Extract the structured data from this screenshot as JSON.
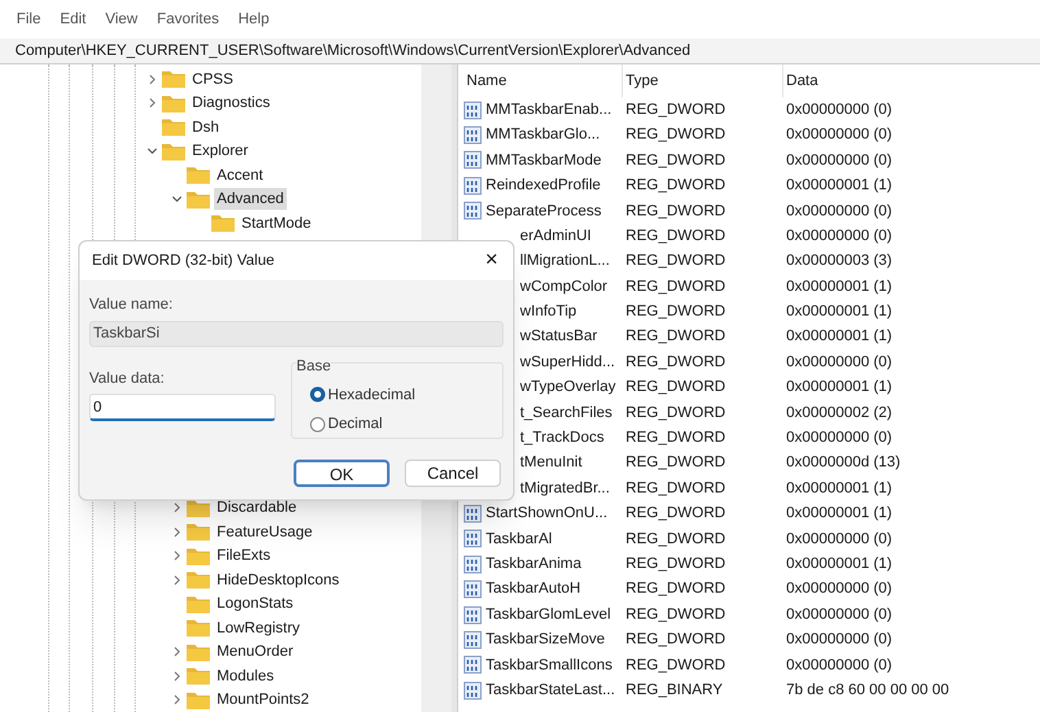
{
  "menu": [
    "File",
    "Edit",
    "View",
    "Favorites",
    "Help"
  ],
  "address": "Computer\\HKEY_CURRENT_USER\\Software\\Microsoft\\Windows\\CurrentVersion\\Explorer\\Advanced",
  "tree": {
    "upper": [
      {
        "label": "CPSS",
        "expandable": true,
        "expanded": false,
        "selected": false
      },
      {
        "label": "Diagnostics",
        "expandable": true,
        "expanded": false,
        "selected": false
      },
      {
        "label": "Dsh",
        "expandable": false,
        "selected": false
      },
      {
        "label": "Explorer",
        "expandable": true,
        "expanded": true,
        "selected": false,
        "children": [
          {
            "label": "Accent",
            "expandable": false,
            "selected": false
          },
          {
            "label": "Advanced",
            "expandable": true,
            "expanded": true,
            "selected": true,
            "children": [
              {
                "label": "StartMode",
                "expandable": false,
                "selected": false
              }
            ]
          }
        ]
      }
    ],
    "lower": [
      {
        "label": "Discardable",
        "expandable": true,
        "expanded": false,
        "selected": false
      },
      {
        "label": "FeatureUsage",
        "expandable": true,
        "expanded": false,
        "selected": false
      },
      {
        "label": "FileExts",
        "expandable": true,
        "expanded": false,
        "selected": false
      },
      {
        "label": "HideDesktopIcons",
        "expandable": true,
        "expanded": false,
        "selected": false
      },
      {
        "label": "LogonStats",
        "expandable": false,
        "selected": false
      },
      {
        "label": "LowRegistry",
        "expandable": false,
        "selected": false
      },
      {
        "label": "MenuOrder",
        "expandable": true,
        "expanded": false,
        "selected": false
      },
      {
        "label": "Modules",
        "expandable": true,
        "expanded": false,
        "selected": false
      },
      {
        "label": "MountPoints2",
        "expandable": true,
        "expanded": false,
        "selected": false
      }
    ]
  },
  "table": {
    "columns": [
      "Name",
      "Type",
      "Data"
    ],
    "rows": [
      {
        "kind": "full",
        "name": "MMTaskbarEnab...",
        "type": "REG_DWORD",
        "data": "0x00000000 (0)"
      },
      {
        "kind": "full",
        "name": "MMTaskbarGlo...",
        "type": "REG_DWORD",
        "data": "0x00000000 (0)"
      },
      {
        "kind": "full",
        "name": "MMTaskbarMode",
        "type": "REG_DWORD",
        "data": "0x00000000 (0)"
      },
      {
        "kind": "full",
        "name": "ReindexedProfile",
        "type": "REG_DWORD",
        "data": "0x00000001 (1)"
      },
      {
        "kind": "full",
        "name": "SeparateProcess",
        "type": "REG_DWORD",
        "data": "0x00000000 (0)"
      },
      {
        "kind": "partial",
        "name": "erAdminUI",
        "type": "REG_DWORD",
        "data": "0x00000000 (0)"
      },
      {
        "kind": "partial",
        "name": "llMigrationL...",
        "type": "REG_DWORD",
        "data": "0x00000003 (3)"
      },
      {
        "kind": "partial",
        "name": "wCompColor",
        "type": "REG_DWORD",
        "data": "0x00000001 (1)"
      },
      {
        "kind": "partial",
        "name": "wInfoTip",
        "type": "REG_DWORD",
        "data": "0x00000001 (1)"
      },
      {
        "kind": "partial",
        "name": "wStatusBar",
        "type": "REG_DWORD",
        "data": "0x00000001 (1)"
      },
      {
        "kind": "partial",
        "name": "wSuperHidd...",
        "type": "REG_DWORD",
        "data": "0x00000000 (0)"
      },
      {
        "kind": "partial",
        "name": "wTypeOverlay",
        "type": "REG_DWORD",
        "data": "0x00000001 (1)"
      },
      {
        "kind": "partial",
        "name": "t_SearchFiles",
        "type": "REG_DWORD",
        "data": "0x00000002 (2)"
      },
      {
        "kind": "partial",
        "name": "t_TrackDocs",
        "type": "REG_DWORD",
        "data": "0x00000000 (0)"
      },
      {
        "kind": "partial",
        "name": "tMenuInit",
        "type": "REG_DWORD",
        "data": "0x0000000d (13)"
      },
      {
        "kind": "partial",
        "name": "tMigratedBr...",
        "type": "REG_DWORD",
        "data": "0x00000001 (1)"
      },
      {
        "kind": "full",
        "name": "StartShownOnU...",
        "type": "REG_DWORD",
        "data": "0x00000001 (1)"
      },
      {
        "kind": "full",
        "name": "TaskbarAl",
        "type": "REG_DWORD",
        "data": "0x00000000 (0)"
      },
      {
        "kind": "full",
        "name": "TaskbarAnima",
        "type": "REG_DWORD",
        "data": "0x00000001 (1)"
      },
      {
        "kind": "full",
        "name": "TaskbarAutoH",
        "type": "REG_DWORD",
        "data": "0x00000000 (0)"
      },
      {
        "kind": "full",
        "name": "TaskbarGlomLevel",
        "type": "REG_DWORD",
        "data": "0x00000000 (0)"
      },
      {
        "kind": "full",
        "name": "TaskbarSizeMove",
        "type": "REG_DWORD",
        "data": "0x00000000 (0)"
      },
      {
        "kind": "full",
        "name": "TaskbarSmallIcons",
        "type": "REG_DWORD",
        "data": "0x00000000 (0)"
      },
      {
        "kind": "full",
        "name": "TaskbarStateLast...",
        "type": "REG_BINARY",
        "data": "7b de c8 60 00 00 00 00"
      }
    ]
  },
  "dialog": {
    "title": "Edit DWORD (32-bit) Value",
    "close": "×",
    "value_name_label": "Value name:",
    "value_name": "TaskbarSi",
    "value_data_label": "Value data:",
    "value_data": "0",
    "base_label": "Base",
    "bases": [
      {
        "label": "Hexadecimal",
        "selected": true
      },
      {
        "label": "Decimal",
        "selected": false
      }
    ],
    "buttons": [
      {
        "label": "OK",
        "default": true
      },
      {
        "label": "Cancel",
        "default": false
      }
    ]
  }
}
